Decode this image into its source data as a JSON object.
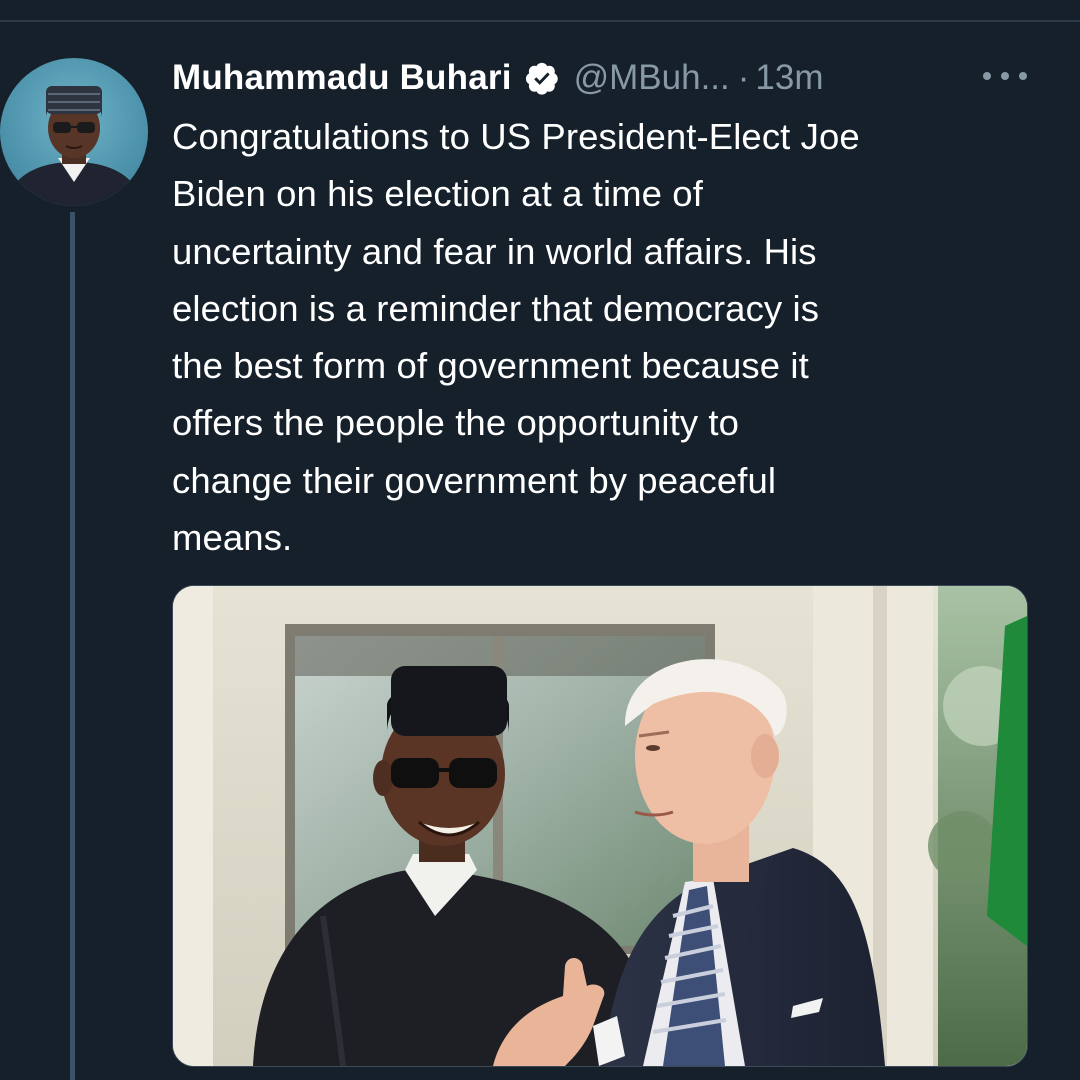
{
  "tweet": {
    "author": {
      "display_name": "Muhammadu Buhari",
      "handle": "@MBuh...",
      "verified": true
    },
    "separator": "·",
    "timestamp": "13m",
    "text_lines": [
      "Congratulations to US President-Elect Joe",
      "Biden on his election at a time of",
      "uncertainty and fear in world affairs. His",
      "election is a reminder that democracy is",
      "the best form of government because it",
      "offers the people the opportunity to",
      "change their government by peaceful",
      "means."
    ],
    "media": {
      "type": "photo"
    }
  },
  "icons": {
    "verified": "verified-badge-icon",
    "more": "more-options-icon"
  },
  "colors": {
    "background": "#15202b",
    "secondary_text": "#8899a6",
    "thread_line": "#3b5366"
  }
}
